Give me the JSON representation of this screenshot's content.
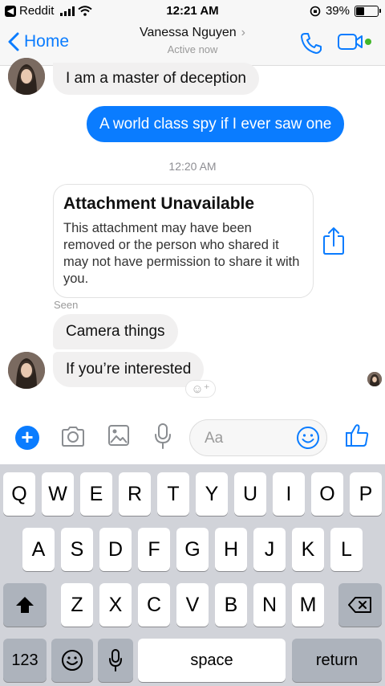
{
  "status_bar": {
    "back_app": "Reddit",
    "time": "12:21 AM",
    "battery": "39%",
    "battery_level": 0.39
  },
  "nav": {
    "back_label": "Home",
    "contact_name": "Vanessa Nguyen",
    "contact_status": "Active now",
    "icons": [
      "phone-icon",
      "video-camera-icon"
    ]
  },
  "conversation": {
    "messages": [
      {
        "direction": "in",
        "text": "I am a master of deception"
      },
      {
        "direction": "out",
        "text": "A world class spy if I ever saw one"
      }
    ],
    "timestamp": "12:20 AM",
    "attachment": {
      "title": "Attachment Unavailable",
      "body": "This attachment may have been removed or the person who shared it may not have permission to share it with you."
    },
    "seen_label": "Seen",
    "messages_after": [
      {
        "direction": "in",
        "text": "Camera things"
      },
      {
        "direction": "in",
        "text": "If you’re interested"
      }
    ]
  },
  "composer": {
    "placeholder": "Aa",
    "icons": [
      "plus-icon",
      "camera-icon",
      "image-icon",
      "microphone-icon",
      "emoji-icon",
      "thumbs-up-icon"
    ]
  },
  "keyboard": {
    "row1": [
      "Q",
      "W",
      "E",
      "R",
      "T",
      "Y",
      "U",
      "I",
      "O",
      "P"
    ],
    "row2": [
      "A",
      "S",
      "D",
      "F",
      "G",
      "H",
      "J",
      "K",
      "L"
    ],
    "row3": [
      "Z",
      "X",
      "C",
      "V",
      "B",
      "N",
      "M"
    ],
    "numbers_key": "123",
    "space_key": "space",
    "return_key": "return"
  },
  "colors": {
    "accent": "#0a7cff",
    "incoming_bubble": "#f1f0f0",
    "keyboard_bg": "#d1d3d9",
    "online_dot": "#42b72a"
  }
}
